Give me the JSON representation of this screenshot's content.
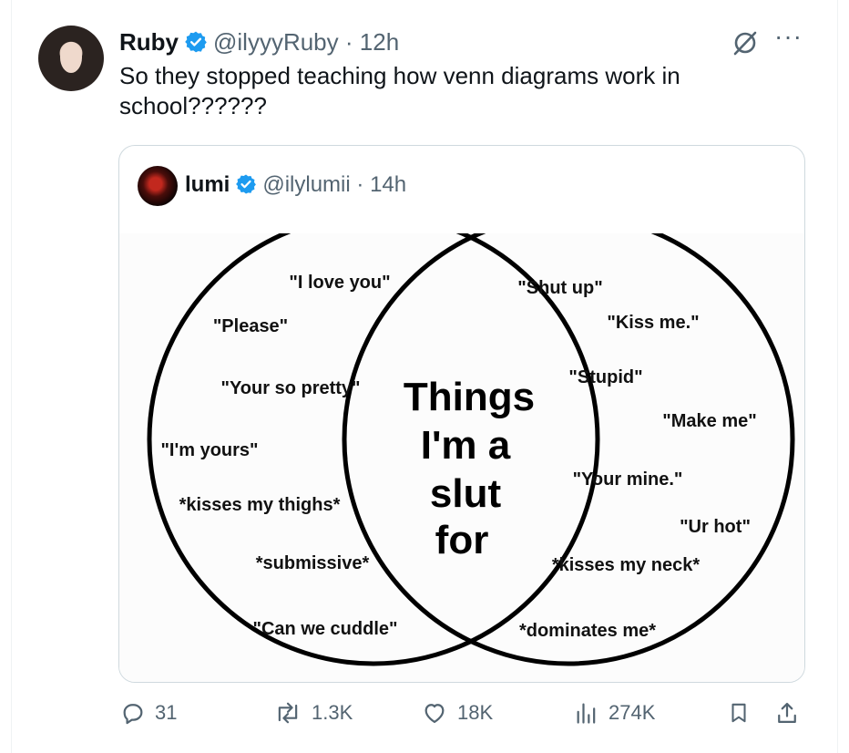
{
  "tweet": {
    "author_name": "Ruby",
    "handle": "@ilyyyRuby",
    "separator": "·",
    "time": "12h",
    "text": "So they stopped teaching how venn diagrams work in school??????"
  },
  "quoted": {
    "author_name": "lumi",
    "handle": "@ilylumii",
    "separator": "·",
    "time": "14h",
    "venn": {
      "center_lines": [
        "Things",
        "I'm a",
        "slut",
        "for"
      ],
      "left_items": [
        "\"I love you\"",
        "\"Please\"",
        "\"Your so pretty\"",
        "\"I'm yours\"",
        "*kisses my thighs*",
        "*submissive*",
        "\"Can we cuddle\""
      ],
      "right_items": [
        "\"Shut up\"",
        "\"Kiss me.\"",
        "\"Stupid\"",
        "\"Make me\"",
        "\"Your mine.\"",
        "\"Ur hot\"",
        "*kisses my neck*",
        "*dominates me*"
      ]
    }
  },
  "actions": {
    "replies": "31",
    "reposts": "1.3K",
    "likes": "18K",
    "views": "274K"
  },
  "colors": {
    "verified": "#1d9bf0",
    "muted": "#536471",
    "border": "#cfd9de"
  },
  "icons": [
    "verified-badge-icon",
    "grok-icon",
    "more-icon",
    "reply-icon",
    "repost-icon",
    "like-icon",
    "views-icon",
    "bookmark-icon",
    "share-icon"
  ]
}
